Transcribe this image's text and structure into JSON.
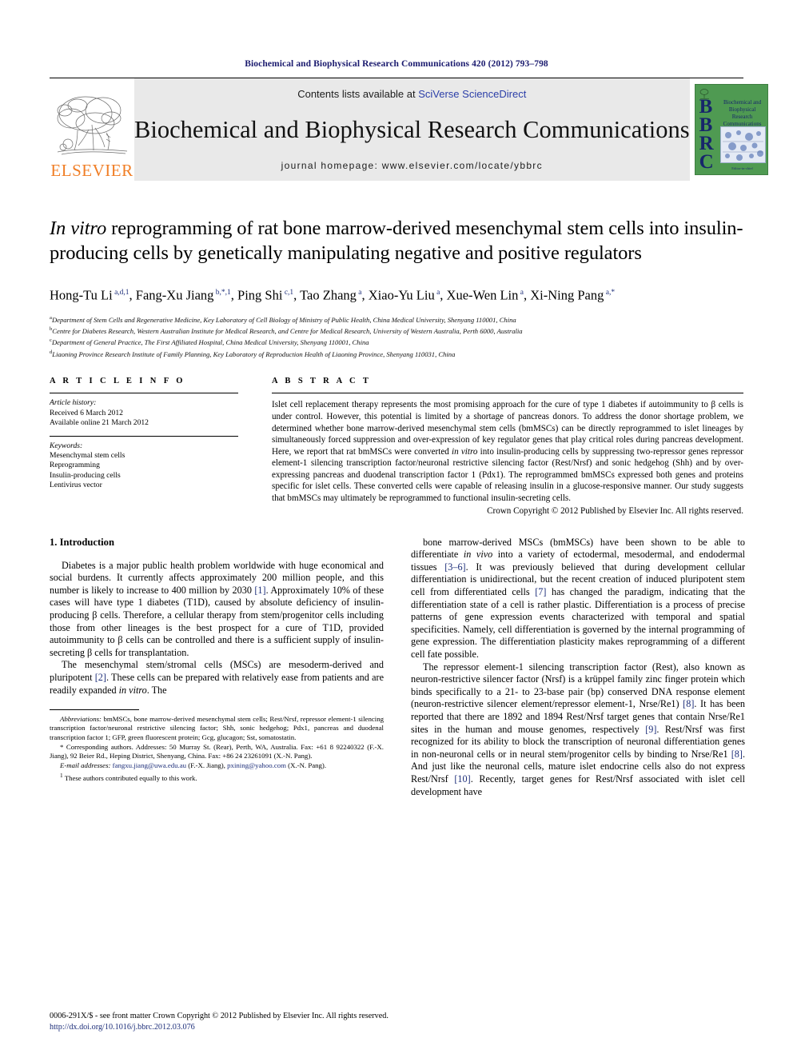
{
  "running_head": "Biochemical and Biophysical Research Communications 420 (2012) 793–798",
  "banner": {
    "publisher_wordmark": "ELSEVIER",
    "contents_prefix": "Contents lists available at ",
    "contents_link": "SciVerse ScienceDirect",
    "journal_title": "Biochemical and Biophysical Research Communications",
    "homepage": "journal homepage: www.elsevier.com/locate/ybbrc",
    "cover": {
      "acronym_letters": [
        "B",
        "B",
        "R",
        "C"
      ],
      "cover_title": "Biochemical and Biophysical Research Communications",
      "cover_footer": "Editor-in-chief",
      "background_color": "#4f9a52",
      "text_color": "#17266b"
    },
    "link_color": "#2b3ea8",
    "elsevier_color": "#f07e26"
  },
  "article": {
    "title_italic_lead": "In vitro",
    "title_rest": " reprogramming of rat bone marrow-derived mesenchymal stem cells into insulin-producing cells by genetically manipulating negative and positive regulators",
    "authors": [
      {
        "name": "Hong-Tu Li",
        "sup": "a,d,1"
      },
      {
        "name": "Fang-Xu Jiang",
        "sup": "b,*,1"
      },
      {
        "name": "Ping Shi",
        "sup": "c,1"
      },
      {
        "name": "Tao Zhang",
        "sup": "a"
      },
      {
        "name": "Xiao-Yu Liu",
        "sup": "a"
      },
      {
        "name": "Xue-Wen Lin",
        "sup": "a"
      },
      {
        "name": "Xi-Ning Pang",
        "sup": "a,*"
      }
    ],
    "affiliations": [
      {
        "label": "a",
        "text": "Department of Stem Cells and Regenerative Medicine, Key Laboratory of Cell Biology of Ministry of Public Health, China Medical University, Shenyang 110001, China"
      },
      {
        "label": "b",
        "text": "Centre for Diabetes Research, Western Australian Institute for Medical Research, and Centre for Medical Research, University of Western Australia, Perth 6000, Australia"
      },
      {
        "label": "c",
        "text": "Department of General Practice, The First Affiliated Hospital, China Medical University, Shenyang 110001, China"
      },
      {
        "label": "d",
        "text": "Liaoning Province Research Institute of Family Planning, Key Laboratory of Reproduction Health of Liaoning Province, Shenyang 110031, China"
      }
    ]
  },
  "article_info": {
    "heading": "A R T I C L E   I N F O",
    "history_title": "Article history:",
    "history_lines": [
      "Received 6 March 2012",
      "Available online 21 March 2012"
    ],
    "keywords_title": "Keywords:",
    "keywords": [
      "Mesenchymal stem cells",
      "Reprogramming",
      "Insulin-producing cells",
      "Lentivirus vector"
    ]
  },
  "abstract": {
    "heading": "A B S T R A C T",
    "part1": "Islet cell replacement therapy represents the most promising approach for the cure of type 1 diabetes if autoimmunity to β cells is under control. However, this potential is limited by a shortage of pancreas donors. To address the donor shortage problem, we determined whether bone marrow-derived mesenchymal stem cells (bmMSCs) can be directly reprogrammed to islet lineages by simultaneously forced suppression and over-expression of key regulator genes that play critical roles during pancreas development. Here, we report that rat bmMSCs were converted ",
    "italic1": "in vitro",
    "part2": " into insulin-producing cells by suppressing two-repressor genes repressor element-1 silencing transcription factor/neuronal restrictive silencing factor (Rest/Nrsf) and sonic hedgehog (Shh) and by over-expressing pancreas and duodenal transcription factor 1 (Pdx1). The reprogrammed bmMSCs expressed both genes and proteins specific for islet cells. These converted cells were capable of releasing insulin in a glucose-responsive manner. Our study suggests that bmMSCs may ultimately be reprogrammed to functional insulin-secreting cells.",
    "copyright": "Crown Copyright © 2012 Published by Elsevier Inc. All rights reserved."
  },
  "body": {
    "section_title": "1. Introduction",
    "left_paragraphs": [
      {
        "segments": [
          {
            "t": "Diabetes is a major public health problem worldwide with huge economical and social burdens. It currently affects approximately 200 million people, and this number is likely to increase to 400 million by 2030 "
          },
          {
            "t": "[1]",
            "style": "ref"
          },
          {
            "t": ". Approximately 10% of these cases will have type 1 diabetes (T1D), caused by absolute deficiency of insulin-producing β cells. Therefore, a cellular therapy from stem/progenitor cells including those from other lineages is the best prospect for a cure of T1D, provided autoimmunity to β cells can be controlled and there is a sufficient supply of insulin-secreting β cells for transplantation."
          }
        ]
      },
      {
        "segments": [
          {
            "t": "The mesenchymal stem/stromal cells (MSCs) are mesoderm-derived and pluripotent "
          },
          {
            "t": "[2]",
            "style": "ref"
          },
          {
            "t": ". These cells can be prepared with relatively ease from patients and are readily expanded "
          },
          {
            "t": "in vitro",
            "style": "em"
          },
          {
            "t": ". The"
          }
        ]
      }
    ],
    "right_paragraphs": [
      {
        "segments": [
          {
            "t": "bone marrow-derived MSCs (bmMSCs) have been shown to be able to differentiate "
          },
          {
            "t": "in vivo",
            "style": "em"
          },
          {
            "t": " into a variety of ectodermal, mesodermal, and endodermal tissues "
          },
          {
            "t": "[3–6]",
            "style": "ref"
          },
          {
            "t": ". It was previously believed that during development cellular differentiation is unidirectional, but the recent creation of induced pluripotent stem cell from differentiated cells "
          },
          {
            "t": "[7]",
            "style": "ref"
          },
          {
            "t": " has changed the paradigm, indicating that the differentiation state of a cell is rather plastic. Differentiation is a process of precise patterns of gene expression events characterized with temporal and spatial specificities. Namely, cell differentiation is governed by the internal programming of gene expression. The differentiation plasticity makes reprogramming of a different cell fate possible."
          }
        ]
      },
      {
        "segments": [
          {
            "t": "The repressor element-1 silencing transcription factor (Rest), also known as neuron-restrictive silencer factor (Nrsf) is a krüppel family zinc finger protein which binds specifically to a 21- to 23-base pair (bp) conserved DNA response element (neuron-restrictive silencer element/repressor element-1, Nrse/Re1) "
          },
          {
            "t": "[8]",
            "style": "ref"
          },
          {
            "t": ". It has been reported that there are 1892 and 1894 Rest/Nrsf target genes that contain Nrse/Re1 sites in the human and mouse genomes, respectively "
          },
          {
            "t": "[9]",
            "style": "ref"
          },
          {
            "t": ". Rest/Nrsf was first recognized for its ability to block the transcription of neuronal differentiation genes in non-neuronal cells or in neural stem/progenitor cells by binding to Nrse/Re1 "
          },
          {
            "t": "[8]",
            "style": "ref"
          },
          {
            "t": ". And just like the neuronal cells, mature islet endocrine cells also do not express Rest/Nrsf "
          },
          {
            "t": "[10]",
            "style": "ref"
          },
          {
            "t": ". Recently, target genes for Rest/Nrsf associated with islet cell development have"
          }
        ]
      }
    ]
  },
  "footnotes": {
    "abbreviations_label": "Abbreviations:",
    "abbreviations_text": " bmMSCs, bone marrow-derived mesenchymal stem cells; Rest/Nrsf, repressor element-1 silencing transcription factor/neuronal restrictive silencing factor; Shh, sonic hedgehog; Pdx1, pancreas and duodenal transcription factor 1; GFP, green fluorescent protein; Gcg, glucagon; Sst, somatostatin.",
    "corresponding_marker": "*",
    "corresponding_text": " Corresponding authors. Addresses: 50 Murray St. (Rear), Perth, WA, Australia. Fax: +61 8 92240322 (F.-X. Jiang), 92 Beier Rd., Heping District, Shenyang, China. Fax: +86 24 23261091 (X.-N. Pang).",
    "email_label": "E-mail addresses:",
    "email_1": "fangxu.jiang@uwa.edu.au",
    "email_1_who": " (F.-X. Jiang), ",
    "email_2": "pxining@yahoo.com",
    "email_2_who": " (X.-N. Pang).",
    "equal_marker": "1",
    "equal_text": " These authors contributed equally to this work."
  },
  "page_footer": {
    "issn_line": "0006-291X/$ - see front matter Crown Copyright © 2012 Published by Elsevier Inc. All rights reserved.",
    "doi": "http://dx.doi.org/10.1016/j.bbrc.2012.03.076"
  }
}
